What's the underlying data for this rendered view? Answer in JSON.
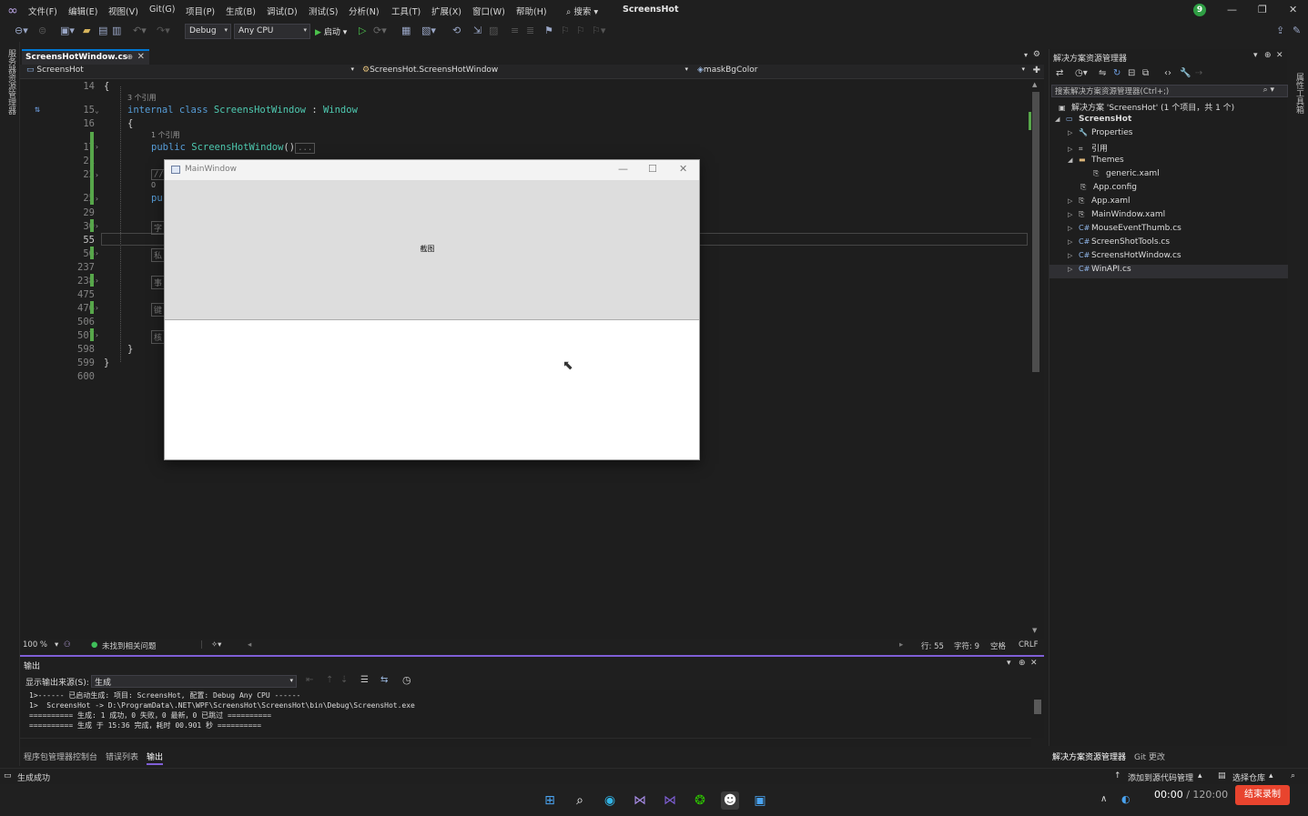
{
  "menubar": {
    "items": [
      "文件(F)",
      "编辑(E)",
      "视图(V)",
      "Git(G)",
      "项目(P)",
      "生成(B)",
      "调试(D)",
      "测试(S)",
      "分析(N)",
      "工具(T)",
      "扩展(X)",
      "窗口(W)",
      "帮助(H)"
    ],
    "search": "搜索",
    "title": "ScreensHot",
    "badge": "9"
  },
  "toolbar": {
    "config": "Debug",
    "platform": "Any CPU",
    "start": "启动"
  },
  "left_strip": "服务器资源管理器",
  "right_strip": "属性工具箱",
  "editor": {
    "tab": "ScreensHotWindow.cs",
    "nav": [
      "ScreensHot",
      "ScreensHot.ScreensHotWindow",
      "maskBgColor"
    ],
    "ref3": "3 个引用",
    "ref1": "1 个引用",
    "ref0": "0",
    "line_numbers": [
      "14",
      "15",
      "16",
      "17",
      "21",
      "22",
      "25",
      "29",
      "30",
      "55",
      "56",
      "237",
      "238",
      "475",
      "476",
      "506",
      "507",
      "598",
      "599",
      "600"
    ],
    "code_class_kw1": "internal",
    "code_class_kw2": "class",
    "code_class_name": "ScreensHotWindow",
    "code_class_sep": " : ",
    "code_class_base": "Window",
    "code_ctor_kw": "public",
    "code_ctor_name": "ScreensHotWindow",
    "code_ctor_tail": "()",
    "code_ellipsis": "...",
    "code_brace_open": "{",
    "code_brace_close": "}",
    "frag_comment": "//",
    "frag_pu": "pu",
    "frag_zi": "字",
    "frag_si": "私",
    "frag_shi": "事",
    "frag_jian": "键",
    "frag_he": "核"
  },
  "editor_status": {
    "zoom": "100 %",
    "issues": "未找到相关问题",
    "line": "行: 55",
    "col": "字符: 9",
    "spaces": "空格",
    "eol": "CRLF"
  },
  "output": {
    "title": "输出",
    "source_label": "显示输出来源(S):",
    "source_value": "生成",
    "lines": [
      "1>------ 已启动生成: 项目: ScreensHot, 配置: Debug Any CPU ------",
      "1>  ScreensHot -> D:\\ProgramData\\.NET\\WPF\\ScreensHot\\ScreensHot\\bin\\Debug\\ScreensHot.exe",
      "========== 生成: 1 成功，0 失败，0 最新，0 已跳过 ==========",
      "========== 生成 于 15:36 完成，耗时 00.901 秒 =========="
    ]
  },
  "bottom_tabs": [
    "程序包管理器控制台",
    "错误列表",
    "输出"
  ],
  "solution_explorer": {
    "title": "解决方案资源管理器",
    "search": "搜索解决方案资源管理器(Ctrl+;)",
    "tree": [
      {
        "label": "解决方案 'ScreensHot' (1 个项目，共 1 个)",
        "icon": "solution-icon"
      },
      {
        "label": "ScreensHot",
        "icon": "csharp-project-icon"
      },
      {
        "label": "Properties",
        "icon": "wrench-icon"
      },
      {
        "label": "引用",
        "icon": "references-icon"
      },
      {
        "label": "Themes",
        "icon": "folder-icon"
      },
      {
        "label": "generic.xaml",
        "icon": "xaml-file-icon"
      },
      {
        "label": "App.config",
        "icon": "config-file-icon"
      },
      {
        "label": "App.xaml",
        "icon": "xaml-file-icon"
      },
      {
        "label": "MainWindow.xaml",
        "icon": "xaml-file-icon"
      },
      {
        "label": "MouseEventThumb.cs",
        "icon": "csharp-file-icon"
      },
      {
        "label": "ScreenShotTools.cs",
        "icon": "csharp-file-icon"
      },
      {
        "label": "ScreensHotWindow.cs",
        "icon": "csharp-file-icon"
      },
      {
        "label": "WinAPI.cs",
        "icon": "csharp-file-icon"
      }
    ],
    "bottom_tabs": [
      "解决方案资源管理器",
      "Git 更改"
    ]
  },
  "statusbar": {
    "message": "生成成功",
    "add_source": "添加到源代码管理",
    "select_repo": "选择仓库"
  },
  "taskbar": {
    "rec_time": "00:00",
    "rec_total": " / 120:00",
    "rec_stop": "结束录制"
  },
  "wpf_window": {
    "title": "MainWindow",
    "button": "截图"
  },
  "colors": {
    "accent": "#7f5fd6",
    "tab_accent": "#0078d4",
    "change_bar": "#57a64a",
    "record": "#e8442e"
  }
}
